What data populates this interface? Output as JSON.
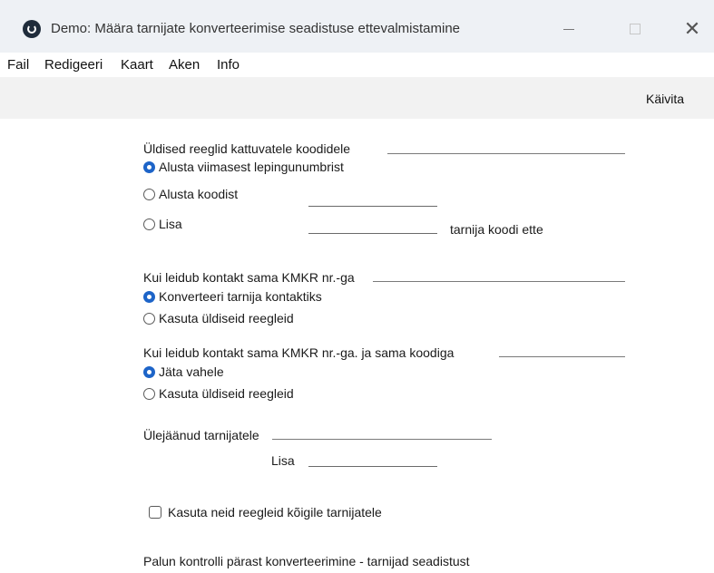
{
  "window": {
    "title": "Demo: Määra tarnijate konverteerimise seadistuse ettevalmistamine",
    "minimize_glyph": "",
    "close_glyph": "✕"
  },
  "menu": [
    "Fail",
    "Redigeeri",
    "Kaart",
    "Aken",
    "Info"
  ],
  "toolbar": {
    "run_label": "Käivita"
  },
  "general": {
    "heading": "Üldised reeglid kattuvatele koodidele",
    "options": [
      {
        "label": "Alusta viimasest lepingunumbrist",
        "selected": true
      },
      {
        "label": "Alusta koodist",
        "selected": false,
        "value": ""
      },
      {
        "label": "Lisa",
        "selected": false,
        "value": ""
      }
    ],
    "suffix": "tarnija koodi ette"
  },
  "same_reg": {
    "heading": "Kui leidub kontakt sama KMKR nr.-ga",
    "options": [
      {
        "label": "Konverteeri tarnija kontaktiks",
        "selected": true
      },
      {
        "label": "Kasuta üldiseid reegleid",
        "selected": false
      }
    ]
  },
  "same_reg_code": {
    "heading": "Kui leidub kontakt sama KMKR nr.-ga. ja sama koodiga",
    "options": [
      {
        "label": "Jäta vahele",
        "selected": true
      },
      {
        "label": "Kasuta üldiseid reegleid",
        "selected": false
      }
    ]
  },
  "remaining": {
    "heading": "Ülejäänud tarnijatele",
    "add_label": "Lisa",
    "add_value": ""
  },
  "apply_all": {
    "label": "Kasuta neid reegleid kõigile tarnijatele",
    "checked": false
  },
  "footer_note": "Palun kontrolli pärast konverteerimine - tarnijad seadistust",
  "colors": {
    "accent": "#1d64c8",
    "titlebar": "#eef1f5",
    "toolbar": "#f2f2f2"
  }
}
